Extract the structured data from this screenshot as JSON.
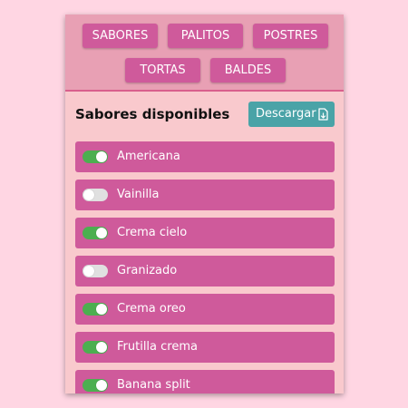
{
  "nav": {
    "buttons": [
      "SABORES",
      "PALITOS",
      "POSTRES",
      "TORTAS",
      "BALDES"
    ]
  },
  "header": {
    "title": "Sabores disponibles",
    "download_label": "Descargar"
  },
  "flavors": [
    {
      "name": "Americana",
      "enabled": true
    },
    {
      "name": "Vainilla",
      "enabled": false
    },
    {
      "name": "Crema cielo",
      "enabled": true
    },
    {
      "name": "Granizado",
      "enabled": false
    },
    {
      "name": "Crema oreo",
      "enabled": true
    },
    {
      "name": "Frutilla crema",
      "enabled": true
    },
    {
      "name": "Banana split",
      "enabled": true
    }
  ],
  "colors": {
    "background": "#ffd6e3",
    "panel": "#f9c9cd",
    "nav_bar": "#e8a0b4",
    "pink_accent": "#cf5a9b",
    "download_button": "#4aa3a7",
    "toggle_on": "#4caf50",
    "toggle_off": "#e0e0e0"
  },
  "icons": {
    "download": "file-download-icon"
  }
}
